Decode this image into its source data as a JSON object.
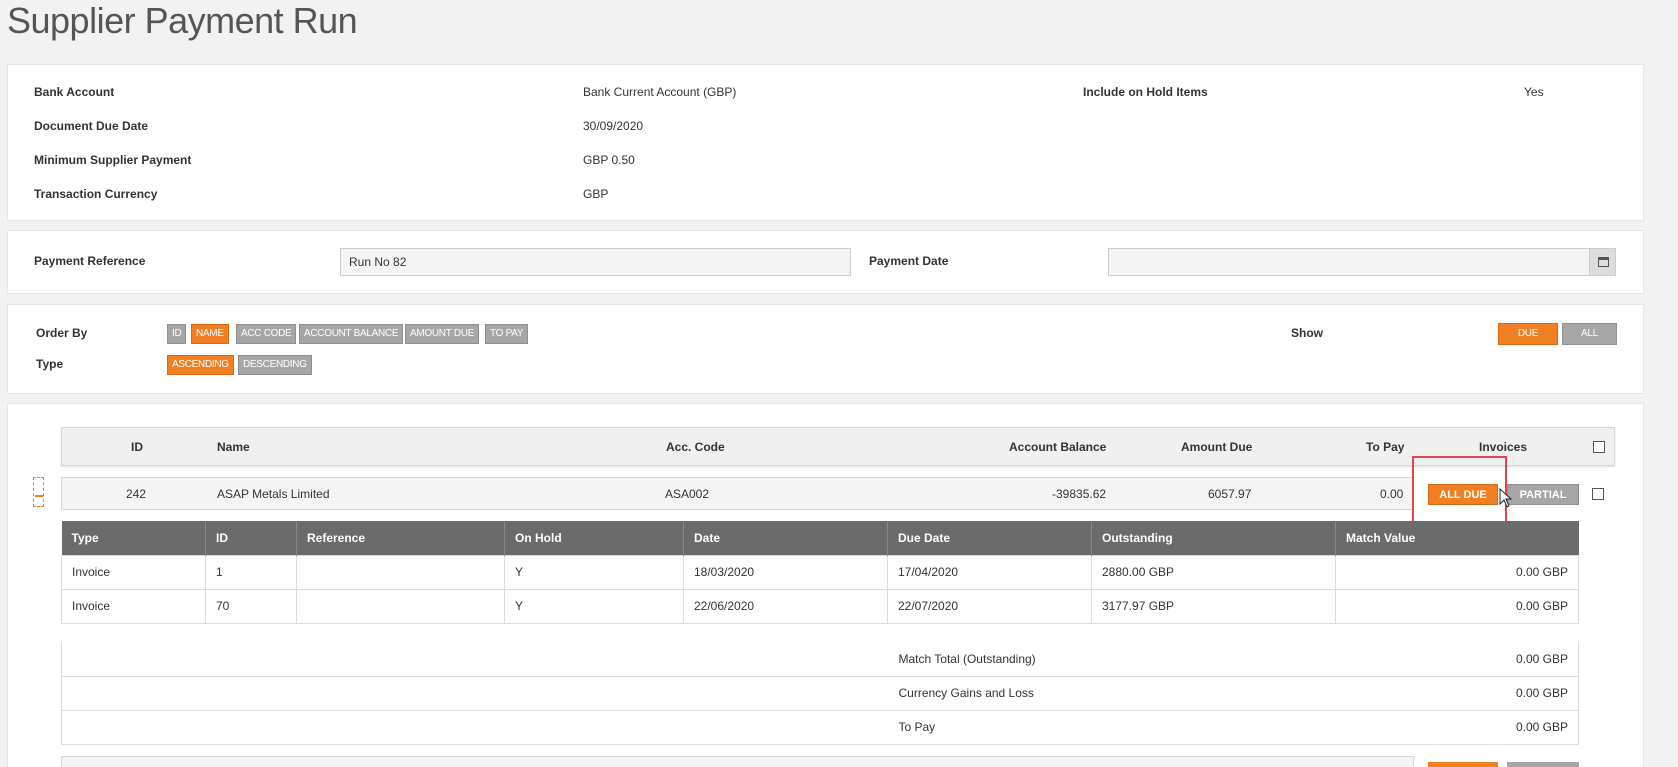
{
  "page": {
    "title": "Supplier Payment Run"
  },
  "summary": {
    "bank_account_label": "Bank Account",
    "bank_account_value": "Bank Current Account (GBP)",
    "due_date_label": "Document Due Date",
    "due_date_value": "30/09/2020",
    "min_payment_label": "Minimum Supplier Payment",
    "min_payment_value": "GBP 0.50",
    "currency_label": "Transaction Currency",
    "currency_value": "GBP",
    "on_hold_label": "Include on Hold Items",
    "on_hold_value": "Yes"
  },
  "payment": {
    "reference_label": "Payment Reference",
    "reference_value": "Run No 82",
    "date_label": "Payment Date",
    "date_value": ""
  },
  "ordering": {
    "order_by_label": "Order By",
    "order_by_options": [
      "ID",
      "NAME",
      "ACC CODE",
      "ACCOUNT BALANCE",
      "AMOUNT DUE",
      "TO PAY"
    ],
    "order_by_selected": "NAME",
    "type_label": "Type",
    "type_options": [
      "ASCENDING",
      "DESCENDING"
    ],
    "type_selected": "ASCENDING",
    "show_label": "Show",
    "show_options": [
      "DUE",
      "ALL"
    ],
    "show_selected": "DUE"
  },
  "suppliers_table": {
    "headers": {
      "id": "ID",
      "name": "Name",
      "acc_code": "Acc. Code",
      "account_balance": "Account Balance",
      "amount_due": "Amount Due",
      "to_pay": "To Pay",
      "invoices": "Invoices"
    },
    "rows": [
      {
        "id": "242",
        "name": "ASAP Metals Limited",
        "acc_code": "ASA002",
        "account_balance": "-39835.62",
        "amount_due": "6057.97",
        "to_pay": "0.00",
        "all_due_label": "ALL DUE",
        "partial_label": "PARTIAL"
      }
    ]
  },
  "invoices": {
    "headers": [
      "Type",
      "ID",
      "Reference",
      "On Hold",
      "Date",
      "Due Date",
      "Outstanding",
      "Match Value"
    ],
    "rows": [
      [
        "Invoice",
        "1",
        "",
        "Y",
        "18/03/2020",
        "17/04/2020",
        "2880.00 GBP",
        "0.00 GBP"
      ],
      [
        "Invoice",
        "70",
        "",
        "Y",
        "22/06/2020",
        "22/07/2020",
        "3177.97 GBP",
        "0.00 GBP"
      ]
    ],
    "totals": [
      {
        "label": "Match Total (Outstanding)",
        "value": "0.00 GBP"
      },
      {
        "label": "Currency Gains and Loss",
        "value": "0.00 GBP"
      },
      {
        "label": "To Pay",
        "value": "0.00 GBP"
      }
    ]
  },
  "colors": {
    "accent": "#f07f23",
    "inactive": "#a6a6a6",
    "highlight": "#e8424a",
    "table_header": "#6b6b6b"
  }
}
